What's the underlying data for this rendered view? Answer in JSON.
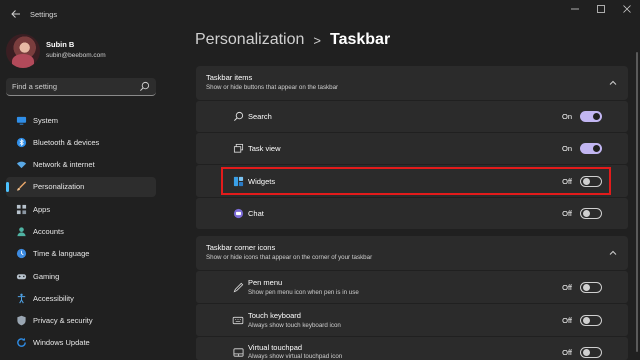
{
  "window": {
    "app_title": "Settings"
  },
  "profile": {
    "name": "Subin B",
    "email": "subin@beebom.com"
  },
  "search": {
    "placeholder": "Find a setting"
  },
  "sidebar": {
    "items": [
      {
        "label": "System",
        "icon": "monitor-icon",
        "active": false
      },
      {
        "label": "Bluetooth & devices",
        "icon": "bluetooth-icon",
        "active": false
      },
      {
        "label": "Network & internet",
        "icon": "wifi-icon",
        "active": false
      },
      {
        "label": "Personalization",
        "icon": "brush-icon",
        "active": true
      },
      {
        "label": "Apps",
        "icon": "apps-icon",
        "active": false
      },
      {
        "label": "Accounts",
        "icon": "person-icon",
        "active": false
      },
      {
        "label": "Time & language",
        "icon": "globe-clock-icon",
        "active": false
      },
      {
        "label": "Gaming",
        "icon": "gamepad-icon",
        "active": false
      },
      {
        "label": "Accessibility",
        "icon": "accessibility-icon",
        "active": false
      },
      {
        "label": "Privacy & security",
        "icon": "shield-icon",
        "active": false
      },
      {
        "label": "Windows Update",
        "icon": "update-icon",
        "active": false
      }
    ]
  },
  "breadcrumb": {
    "parent": "Personalization",
    "separator": ">",
    "current": "Taskbar"
  },
  "taskbar_items": {
    "title": "Taskbar items",
    "subtitle": "Show or hide buttons that appear on the taskbar",
    "rows": [
      {
        "label": "Search",
        "state": "On",
        "on": true,
        "icon": "search-icon"
      },
      {
        "label": "Task view",
        "state": "On",
        "on": true,
        "icon": "task-view-icon"
      },
      {
        "label": "Widgets",
        "state": "Off",
        "on": false,
        "icon": "widgets-icon"
      },
      {
        "label": "Chat",
        "state": "Off",
        "on": false,
        "icon": "chat-icon"
      }
    ]
  },
  "corner_icons": {
    "title": "Taskbar corner icons",
    "subtitle": "Show or hide icons that appear on the corner of your taskbar",
    "rows": [
      {
        "label": "Pen menu",
        "sub": "Show pen menu icon when pen is in use",
        "state": "Off",
        "on": false,
        "icon": "pen-icon"
      },
      {
        "label": "Touch keyboard",
        "sub": "Always show touch keyboard icon",
        "state": "Off",
        "on": false,
        "icon": "keyboard-icon"
      },
      {
        "label": "Virtual touchpad",
        "sub": "Always show virtual touchpad icon",
        "state": "Off",
        "on": false,
        "icon": "touchpad-icon"
      }
    ]
  },
  "colors": {
    "accent": "#4cc2ff",
    "toggle_on": "#c2b6f2",
    "highlight": "#e21b1b"
  }
}
